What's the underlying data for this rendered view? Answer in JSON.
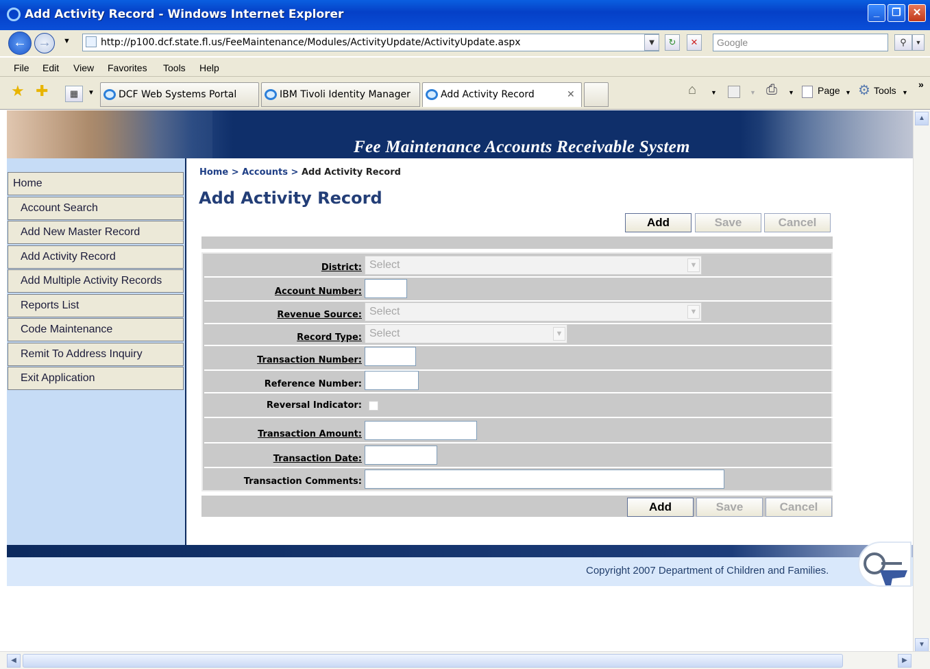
{
  "window": {
    "title": "Add Activity Record - Windows Internet Explorer",
    "buttons": [
      "_",
      "❐",
      "✕"
    ]
  },
  "address": {
    "url": "http://p100.dcf.state.fl.us/FeeMaintenance/Modules/ActivityUpdate/ActivityUpdate.aspx",
    "search_placeholder": "Google"
  },
  "menu": [
    "File",
    "Edit",
    "View",
    "Favorites",
    "Tools",
    "Help"
  ],
  "tabs": [
    {
      "label": "DCF Web Systems Portal"
    },
    {
      "label": "IBM Tivoli Identity Manager"
    },
    {
      "label": "Add Activity Record",
      "active": true
    }
  ],
  "toolbar": {
    "page_label": "Page",
    "tools_label": "Tools"
  },
  "banner": {
    "title": "Fee Maintenance Accounts Receivable System"
  },
  "nav": {
    "items": [
      "Home",
      "Account Search",
      "Add New Master Record",
      "Add Activity Record",
      "Add Multiple Activity Records",
      "Reports List",
      "Code Maintenance",
      "Remit To Address Inquiry",
      "Exit Application"
    ]
  },
  "breadcrumb": {
    "home": "Home",
    "sep1": " > ",
    "accounts": "Accounts",
    "sep2": " > ",
    "current": "Add Activity Record"
  },
  "page_title": "Add Activity Record",
  "buttons": {
    "add": "Add",
    "save": "Save",
    "cancel": "Cancel"
  },
  "form": {
    "district_label": "District:",
    "district_value": "Select",
    "account_number_label": "Account Number:",
    "revenue_source_label": "Revenue Source:",
    "revenue_source_value": "Select",
    "record_type_label": "Record Type:",
    "record_type_value": "Select",
    "transaction_number_label": "Transaction Number:",
    "reference_number_label": "Reference Number:",
    "reversal_indicator_label": "Reversal Indicator:",
    "transaction_amount_label": "Transaction Amount:",
    "transaction_date_label": "Transaction Date:",
    "transaction_comments_label": "Transaction Comments:"
  },
  "footer": {
    "copyright": "Copyright 2007 Department of Children and Families."
  },
  "colors": {
    "titlebar": "#0a4fd8",
    "nav_bg": "#c6dcf6",
    "banner": "#0f2f6a",
    "heading": "#233e77"
  }
}
